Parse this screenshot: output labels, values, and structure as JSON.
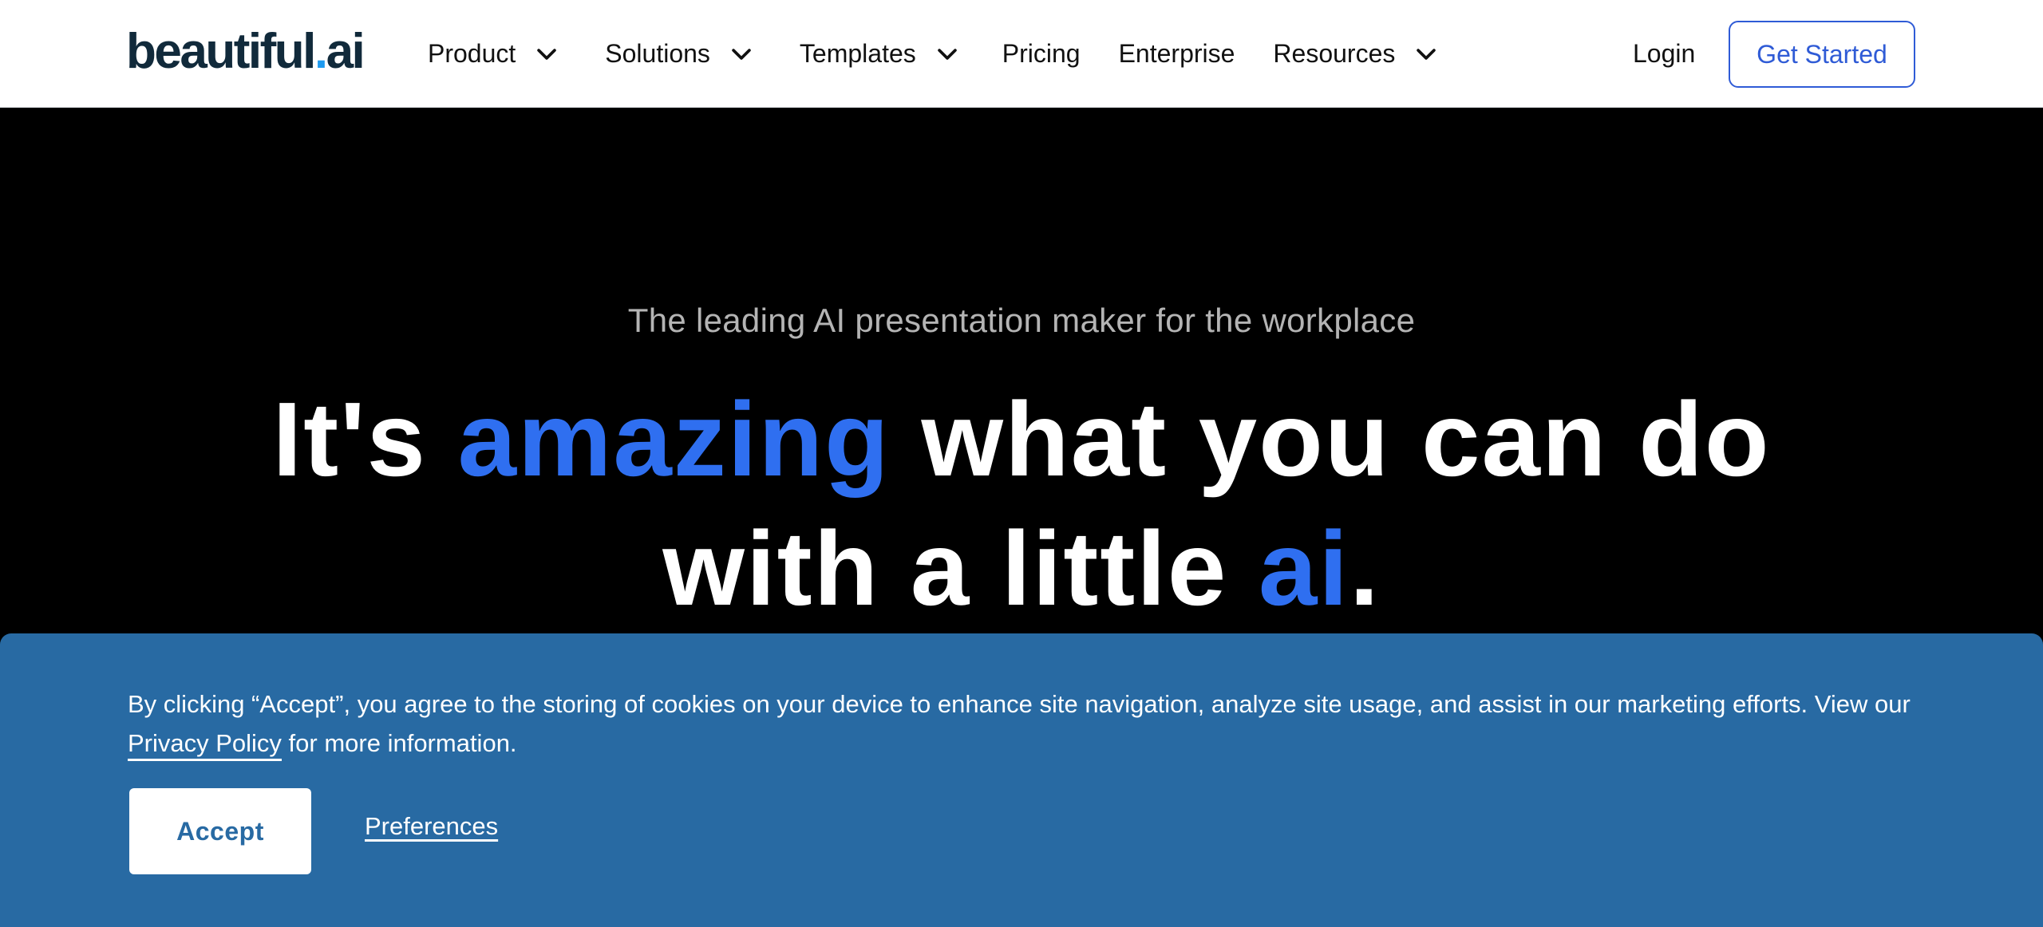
{
  "header": {
    "logo": {
      "text": "beautiful",
      "dot": ".",
      "suffix": "ai"
    },
    "nav": [
      {
        "label": "Product",
        "has_dropdown": true
      },
      {
        "label": "Solutions",
        "has_dropdown": true
      },
      {
        "label": "Templates",
        "has_dropdown": true
      },
      {
        "label": "Pricing",
        "has_dropdown": false
      },
      {
        "label": "Enterprise",
        "has_dropdown": false
      },
      {
        "label": "Resources",
        "has_dropdown": true
      }
    ],
    "login_label": "Login",
    "cta_label": "Get Started"
  },
  "hero": {
    "tagline": "The leading AI presentation maker for the workplace",
    "headline": {
      "part1": "It's ",
      "accent1": "amazing",
      "part2": " what you can do",
      "part3": "with a little ",
      "accent2": "ai",
      "part4": "."
    }
  },
  "cookie_banner": {
    "text_before": "By clicking “Accept”, you agree to the storing of cookies on your device to enhance site navigation, analyze site usage, and assist in our marketing efforts. View our ",
    "policy_link": "Privacy Policy",
    "text_after": " for more information.",
    "accept_label": "Accept",
    "preferences_label": "Preferences"
  },
  "colors": {
    "accent_blue": "#2f6ff0",
    "cta_blue": "#2f5bd6",
    "banner_blue": "#286aa3",
    "logo_navy": "#112a3b"
  },
  "icons": {
    "dropdown": "chevron-down-icon"
  }
}
